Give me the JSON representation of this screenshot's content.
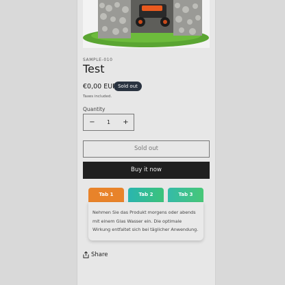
{
  "product": {
    "image_icon": "lawn-mower-garage-photo",
    "sku": "SAMPLE-010",
    "title": "Test",
    "price": "€0,00 EUR",
    "badge": "Sold out",
    "tax_note": "Taxes included."
  },
  "quantity": {
    "label": "Quantity",
    "value": "1",
    "minus": "−",
    "plus": "+"
  },
  "buttons": {
    "sold_out": "Sold out",
    "buy_now": "Buy it now"
  },
  "tabs": {
    "items": [
      {
        "label": "Tab 1",
        "color": "#e8832a"
      },
      {
        "label": "Tab 2",
        "color": "#3cbf95"
      },
      {
        "label": "Tab 3",
        "color": "#3fc18c"
      }
    ],
    "content": "Nehmen Sie das Produkt morgens oder abends mit einem Glas Wasser ein. Die optimale Wirkung entfaltet sich bei täglicher Anwendung."
  },
  "share": {
    "label": "Share",
    "icon": "share-icon"
  }
}
